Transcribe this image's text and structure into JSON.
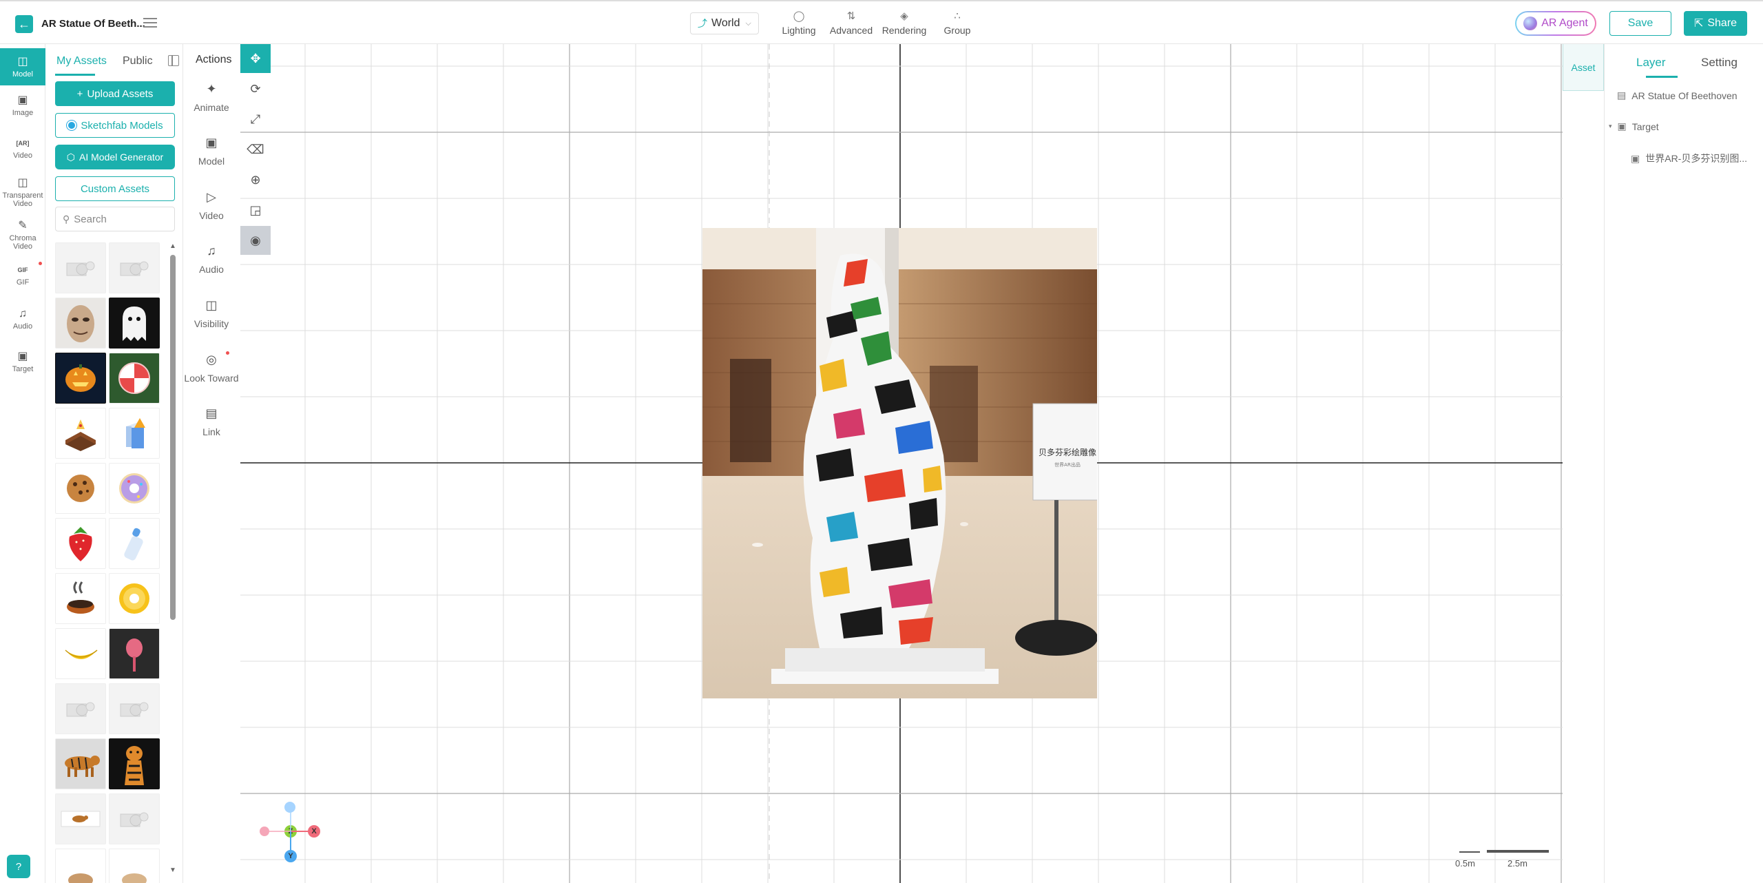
{
  "header": {
    "project_title": "AR Statue Of Beeth...",
    "world_select": "World",
    "tools": [
      {
        "label": "Lighting",
        "icon": "bulb-icon"
      },
      {
        "label": "Advanced",
        "icon": "sliders-icon"
      },
      {
        "label": "Rendering",
        "icon": "paint-bucket-icon"
      },
      {
        "label": "Group",
        "icon": "group-icon"
      }
    ],
    "ar_agent_label": "AR Agent",
    "save_label": "Save",
    "share_label": "Share",
    "accent_color": "#1bb0ad"
  },
  "left_rail": {
    "items": [
      {
        "label": "Model",
        "icon": "cube-icon",
        "active": true
      },
      {
        "label": "Image",
        "icon": "image-icon"
      },
      {
        "label": "Video",
        "icon": "ar-video-icon"
      },
      {
        "label": "Transparent Video",
        "icon": "transparent-video-icon"
      },
      {
        "label": "Chroma Video",
        "icon": "chroma-video-icon"
      },
      {
        "label": "GIF",
        "icon": "gif-icon"
      },
      {
        "label": "Audio",
        "icon": "music-icon"
      },
      {
        "label": "Target",
        "icon": "target-icon"
      }
    ]
  },
  "asset_panel": {
    "tabs": [
      "My Assets",
      "Public"
    ],
    "upload_label": "Upload Assets",
    "sketchfab_label": "Sketchfab Models",
    "ai_generator_label": "AI Model Generator",
    "custom_label": "Custom Assets",
    "search_placeholder": "Search",
    "tiles": [
      {
        "name": "placeholder-model"
      },
      {
        "name": "placeholder-model"
      },
      {
        "name": "mask-face"
      },
      {
        "name": "ghost"
      },
      {
        "name": "pumpkin"
      },
      {
        "name": "peppermint-candy"
      },
      {
        "name": "chocolate-cake"
      },
      {
        "name": "milk-box"
      },
      {
        "name": "cookie"
      },
      {
        "name": "donut"
      },
      {
        "name": "strawberry"
      },
      {
        "name": "baby-bottle"
      },
      {
        "name": "hot-pot"
      },
      {
        "name": "pineapple-ring"
      },
      {
        "name": "banana"
      },
      {
        "name": "lollipop"
      },
      {
        "name": "placeholder-model"
      },
      {
        "name": "placeholder-model"
      },
      {
        "name": "tiger-walking"
      },
      {
        "name": "tiger-front"
      },
      {
        "name": "tiger-small"
      },
      {
        "name": "placeholder-model"
      },
      {
        "name": "partial-1"
      },
      {
        "name": "partial-2"
      }
    ]
  },
  "actions_panel": {
    "title": "Actions",
    "items": [
      {
        "label": "Animate",
        "icon": "sparkle-icon"
      },
      {
        "label": "Model",
        "icon": "model-scan-icon"
      },
      {
        "label": "Video",
        "icon": "video-play-icon"
      },
      {
        "label": "Audio",
        "icon": "music-icon"
      },
      {
        "label": "Visibility",
        "icon": "visibility-icon"
      },
      {
        "label": "Look Toward",
        "icon": "look-toward-icon"
      },
      {
        "label": "Link",
        "icon": "link-icon"
      }
    ]
  },
  "viewport": {
    "gizmo": {
      "z": "Z",
      "x": "X",
      "y": "Y"
    },
    "scale_small": "0.5m",
    "scale_large": "2.5m"
  },
  "right_panel": {
    "asset_tab": "Asset",
    "tabs": [
      "Layer",
      "Setting"
    ],
    "layers": [
      {
        "label": "AR Statue Of Beethoven",
        "icon": "scene-icon"
      },
      {
        "label": "Target",
        "icon": "target-icon"
      },
      {
        "label": "世界AR-贝多芬识别图...",
        "icon": "target-icon"
      }
    ]
  },
  "target_image": {
    "sign_title": "贝多芬彩绘雕像",
    "sign_sub": "世界AR出品"
  }
}
